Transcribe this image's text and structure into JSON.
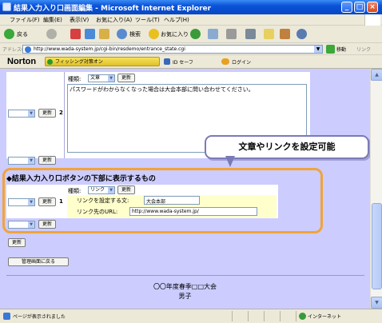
{
  "window": {
    "title": "結果入力入り口画面編集 - Microsoft Internet Explorer"
  },
  "menu": [
    "ファイル(F)",
    "編集(E)",
    "表示(V)",
    "お気に入り(A)",
    "ツール(T)",
    "ヘルプ(H)"
  ],
  "toolbar": {
    "back": "戻る",
    "search": "検索",
    "favorites": "お気に入り"
  },
  "address": {
    "label": "アドレス(D)",
    "url": "http://www.wada-system.jp/cgi-bin/resdemo/entrance_state.cgi",
    "go": "移動",
    "links": "リンク"
  },
  "norton": {
    "logo": "Norton",
    "phish": "フィッシング対策オン",
    "idsafe": "ID セーフ",
    "login": "ログイン"
  },
  "section1": {
    "kind_label": "種類:",
    "kind_value": "文章",
    "update": "更新",
    "row_number": "2",
    "text": "パスワードがわからなくなった場合は大会本部に問い合わせてください。"
  },
  "callout": "文章やリンクを設定可能",
  "section2": {
    "heading": "◆結果入力入り口ボタンの下部に表示するもの",
    "kind_label": "種類:",
    "kind_value": "リンク",
    "update": "更新",
    "row_number": "1",
    "link_text_label": "リンクを設定する文:",
    "link_text_value": "大会本部",
    "link_url_label": "リンク先のURL:",
    "link_url_value": "http://www.wada-system.jp/"
  },
  "buttons": {
    "update": "更新",
    "back_admin": "管理画面に戻る"
  },
  "footer": {
    "line1": "〇〇年度春季□□大会",
    "line2": "男子"
  },
  "status": {
    "message": "ページが表示されました",
    "zone": "インターネット"
  }
}
